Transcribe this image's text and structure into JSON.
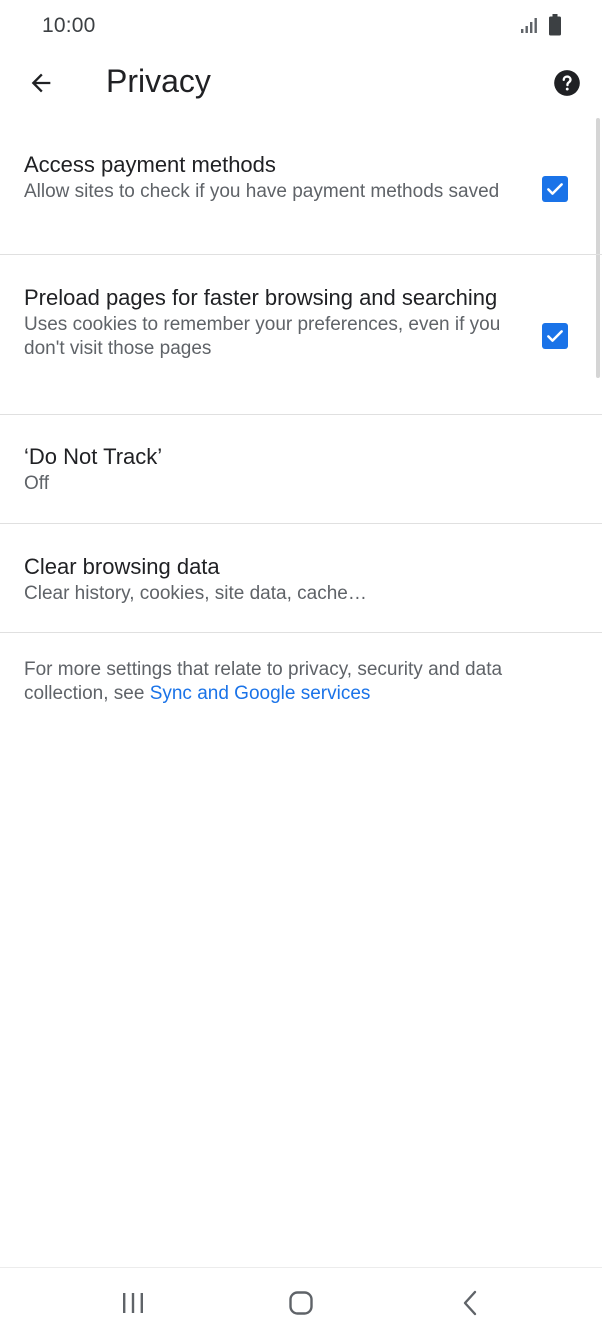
{
  "status_bar": {
    "time": "10:00",
    "icons": [
      "signal-icon",
      "battery-icon"
    ]
  },
  "toolbar": {
    "title": "Privacy",
    "back_icon": "arrow-back-icon",
    "help_icon": "help-icon"
  },
  "settings": [
    {
      "title": "Access payment methods",
      "subtitle": "Allow sites to check if you have payment methods saved",
      "checked": true
    },
    {
      "title": "Preload pages for faster browsing and searching",
      "subtitle": "Uses cookies to remember your preferences, even if you don't visit those pages",
      "checked": true
    },
    {
      "title": "‘Do Not Track’",
      "subtitle": "Off"
    },
    {
      "title": "Clear browsing data",
      "subtitle": "Clear history, cookies, site data, cache…"
    }
  ],
  "footer": {
    "text": "For more settings that relate to privacy, security and data collection, see ",
    "link_text": "Sync and Google services"
  },
  "colors": {
    "accent": "#1a73e8",
    "title_text": "#202124",
    "secondary_text": "#5f6368",
    "divider": "#e0e0e0"
  },
  "nav_bar": {
    "icons": [
      "recents-icon",
      "home-icon",
      "back-icon"
    ]
  }
}
